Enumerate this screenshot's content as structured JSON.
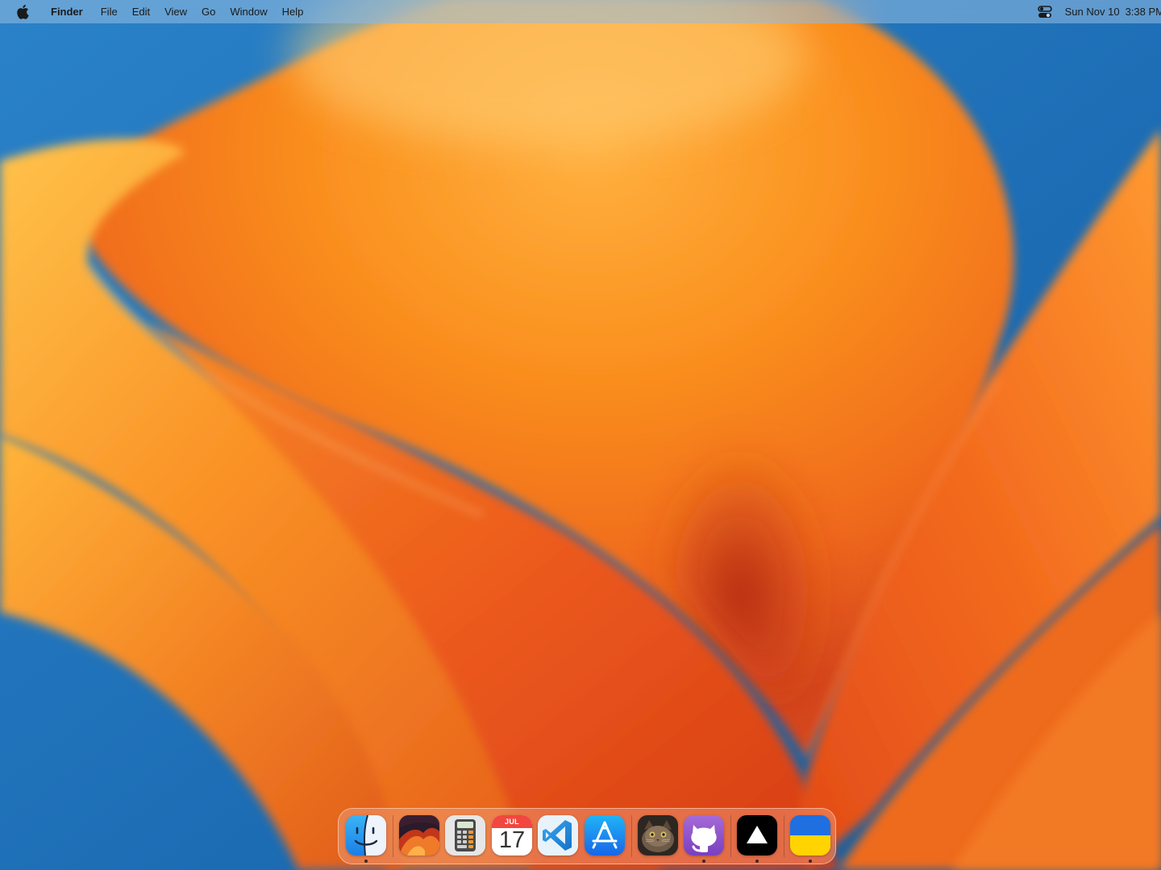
{
  "menubar": {
    "app_name": "Finder",
    "menus": [
      "File",
      "Edit",
      "View",
      "Go",
      "Window",
      "Help"
    ],
    "date": "Sun Nov 10",
    "time": "3:38 PM"
  },
  "dock": {
    "apps": [
      {
        "icon": "finder-icon",
        "running": true
      },
      {
        "icon": "wallpaper-app-icon",
        "running": false
      },
      {
        "icon": "calculator-icon",
        "running": false
      },
      {
        "icon": "calendar-icon",
        "running": false,
        "month": "JUL",
        "day": "17"
      },
      {
        "icon": "vscode-icon",
        "running": false
      },
      {
        "icon": "app-store-icon",
        "running": false
      },
      {
        "icon": "cat-photo-icon",
        "running": false
      },
      {
        "icon": "github-desktop-icon",
        "running": true
      },
      {
        "icon": "triangle-app-icon",
        "running": true
      },
      {
        "icon": "ukraine-flag-icon",
        "running": true
      }
    ]
  },
  "colors": {
    "wallpaper_blue": "#1d6fb8",
    "wallpaper_orange": "#f58a1f",
    "wallpaper_deep_red": "#b3260f"
  }
}
